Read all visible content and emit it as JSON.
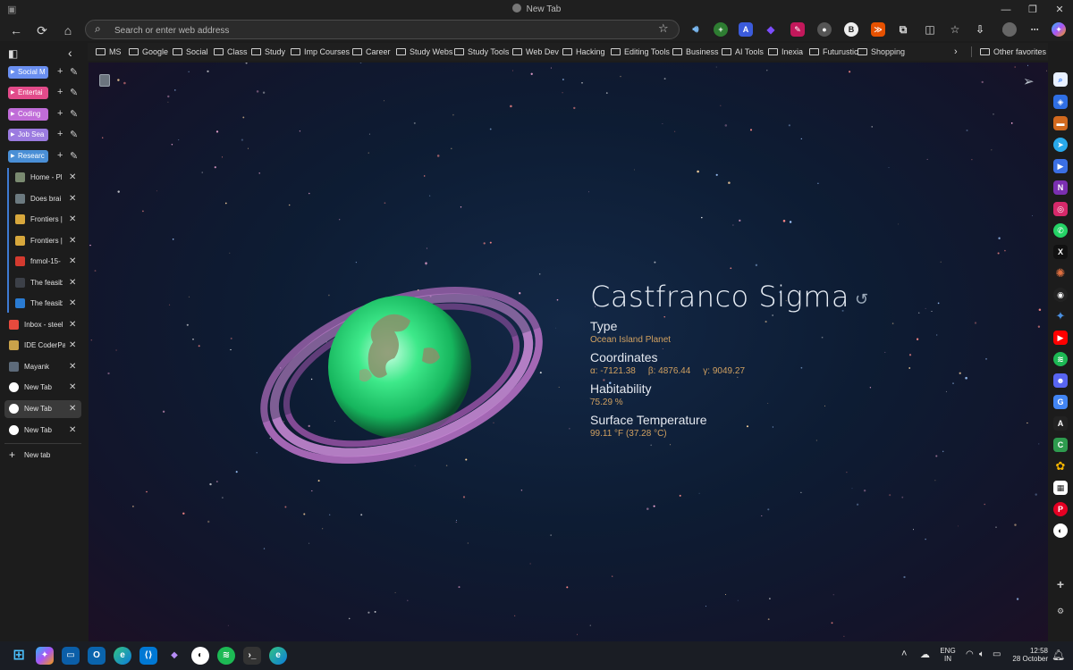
{
  "window": {
    "title": "New Tab"
  },
  "address_bar": {
    "placeholder": "Search or enter web address"
  },
  "bookmarks": [
    "MS",
    "Google",
    "Social",
    "Class",
    "Study",
    "Imp Courses",
    "Career",
    "Study Webs",
    "Study Tools",
    "Web Dev",
    "Hacking",
    "Editing Tools",
    "Business",
    "AI Tools",
    "Inexia",
    "Futurustic",
    "Shopping"
  ],
  "other_favorites": "Other favorites",
  "tab_groups": [
    {
      "label": "Social M",
      "color": "#6a8ff0"
    },
    {
      "label": "Entertai",
      "color": "#e24b8a"
    },
    {
      "label": "Coding",
      "color": "#c06cd8"
    },
    {
      "label": "Job Sea",
      "color": "#9b7be0"
    },
    {
      "label": "Researc",
      "color": "#4a8fd6"
    }
  ],
  "tabs": [
    {
      "title": "Home - Pl",
      "grouped": true,
      "favicon": "#7a8a70"
    },
    {
      "title": "Does brai",
      "grouped": true,
      "favicon": "#6c7a80"
    },
    {
      "title": "Frontiers |",
      "grouped": true,
      "favicon": "#d7a73c"
    },
    {
      "title": "Frontiers |",
      "grouped": true,
      "favicon": "#d7a73c"
    },
    {
      "title": "fnmol-15-",
      "grouped": true,
      "favicon": "#d33a2f"
    },
    {
      "title": "The feasib",
      "grouped": true,
      "favicon": "#3c4048"
    },
    {
      "title": "The feasib",
      "grouped": true,
      "favicon": "#2a7bd2"
    },
    {
      "title": "Inbox - steel",
      "grouped": false,
      "favicon": "#e84a3d"
    },
    {
      "title": "IDE CoderPa",
      "grouped": false,
      "favicon": "#c9a24a"
    },
    {
      "title": "Mayank",
      "grouped": false,
      "favicon": "#5d6a7a"
    },
    {
      "title": "New Tab",
      "grouped": false,
      "favicon": "#ffffff"
    },
    {
      "title": "New Tab",
      "grouped": false,
      "favicon": "#ffffff",
      "active": true
    },
    {
      "title": "New Tab",
      "grouped": false,
      "favicon": "#ffffff"
    }
  ],
  "new_tab_label": "New tab",
  "planet": {
    "name": "Castfranco Sigma",
    "type_label": "Type",
    "type": "Ocean Island Planet",
    "coordinates_label": "Coordinates",
    "alpha": "α: -7121.38",
    "beta": "β: 4876.44",
    "gamma": "γ: 9049.27",
    "habitability_label": "Habitability",
    "habitability": "75.29 %",
    "temperature_label": "Surface Temperature",
    "temperature": "99.11 °F (37.28 °C)"
  },
  "tray": {
    "lang": "ENG",
    "region": "IN",
    "time": "12:58",
    "date": "28 October"
  },
  "icons": {
    "right_sidebar": [
      "tag-icon",
      "briefcase-icon",
      "telegram-icon",
      "play-icon",
      "onenote-icon",
      "instagram-icon",
      "whatsapp-icon",
      "x-icon",
      "burst-icon",
      "aperture-icon",
      "sparkle-icon",
      "youtube-icon",
      "spotify-icon",
      "discord-icon",
      "translate-icon",
      "font-icon",
      "code-icon",
      "flower-icon",
      "grid-icon",
      "pinterest-icon",
      "github-icon"
    ]
  },
  "colors": {
    "planet_green": "#2bd67b",
    "ring": "#b978c6",
    "accent_gold": "#d0a060"
  }
}
